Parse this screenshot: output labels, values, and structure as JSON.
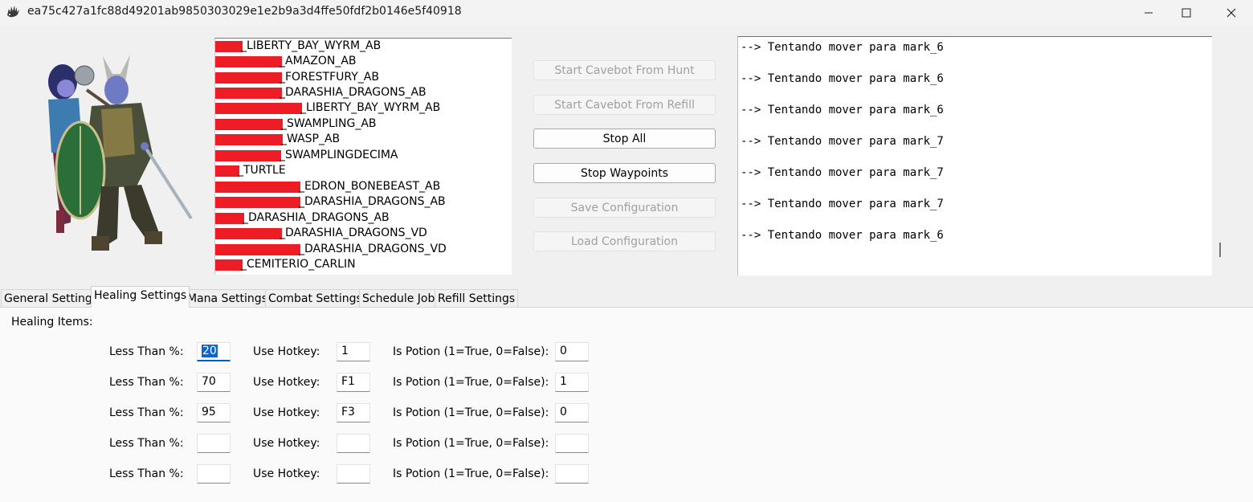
{
  "window": {
    "title": "ea75c427a1fc88d49201ab9850303029e1e2b9a3d4ffe50fdf2b0146e5f40918",
    "app_icon": "hedgehog-icon",
    "controls": [
      "minimize-icon",
      "maximize-icon",
      "close-icon"
    ]
  },
  "waypoint_list": {
    "items": [
      {
        "label": "_LIBERTY_BAY_WYRM_AB"
      },
      {
        "label": "_AMAZON_AB"
      },
      {
        "label": "_FORESTFURY_AB"
      },
      {
        "label": "_DARASHIA_DRAGONS_AB"
      },
      {
        "label": "_LIBERTY_BAY_WYRM_AB"
      },
      {
        "label": "_SWAMPLING_AB"
      },
      {
        "label": "_WASP_AB"
      },
      {
        "label": "_SWAMPLINGDECIMA"
      },
      {
        "label": "_TURTLE"
      },
      {
        "label": "_EDRON_BONEBEAST_AB"
      },
      {
        "label": "_DARASHIA_DRAGONS_AB"
      },
      {
        "label": "_DARASHIA_DRAGONS_AB"
      },
      {
        "label": "_DARASHIA_DRAGONS_VD"
      },
      {
        "label": "_DARASHIA_DRAGONS_VD"
      },
      {
        "label": "_CEMITERIO_CARLIN"
      }
    ]
  },
  "buttons": {
    "start_from_hunt": "Start Cavebot From Hunt",
    "start_from_refill": "Start Cavebot From Refill",
    "stop_all": "Stop All",
    "stop_waypoints": "Stop Waypoints",
    "save_config": "Save Configuration",
    "load_config": "Load Configuration"
  },
  "console": {
    "lines": [
      "--> Tentando mover para mark_6",
      "--> Tentando mover para mark_6",
      "--> Tentando mover para mark_6",
      "--> Tentando mover para mark_7",
      "--> Tentando mover para mark_7",
      "--> Tentando mover para mark_7",
      "--> Tentando mover para mark_6"
    ]
  },
  "tabs": [
    {
      "label": "General Settings",
      "active": false
    },
    {
      "label": "Healing Settings",
      "active": true
    },
    {
      "label": "Mana Settings",
      "active": false
    },
    {
      "label": "Combat Settings",
      "active": false
    },
    {
      "label": "Schedule Job",
      "active": false
    },
    {
      "label": "Refill Settings",
      "active": false
    }
  ],
  "healing": {
    "section_label": "Healing Items:",
    "col_labels": {
      "less_than": "Less Than %:",
      "hotkey": "Use Hotkey:",
      "is_potion": "Is Potion (1=True, 0=False):"
    },
    "rows": [
      {
        "less_than": "20",
        "hotkey": "1",
        "is_potion": "0"
      },
      {
        "less_than": "70",
        "hotkey": "F1",
        "is_potion": "1"
      },
      {
        "less_than": "95",
        "hotkey": "F3",
        "is_potion": "0"
      },
      {
        "less_than": "",
        "hotkey": "",
        "is_potion": ""
      },
      {
        "less_than": "",
        "hotkey": "",
        "is_potion": ""
      }
    ]
  },
  "colors": {
    "redaction": "#ee1d25",
    "selection": "#0a64d6",
    "focus_underline": "#005fb8"
  }
}
